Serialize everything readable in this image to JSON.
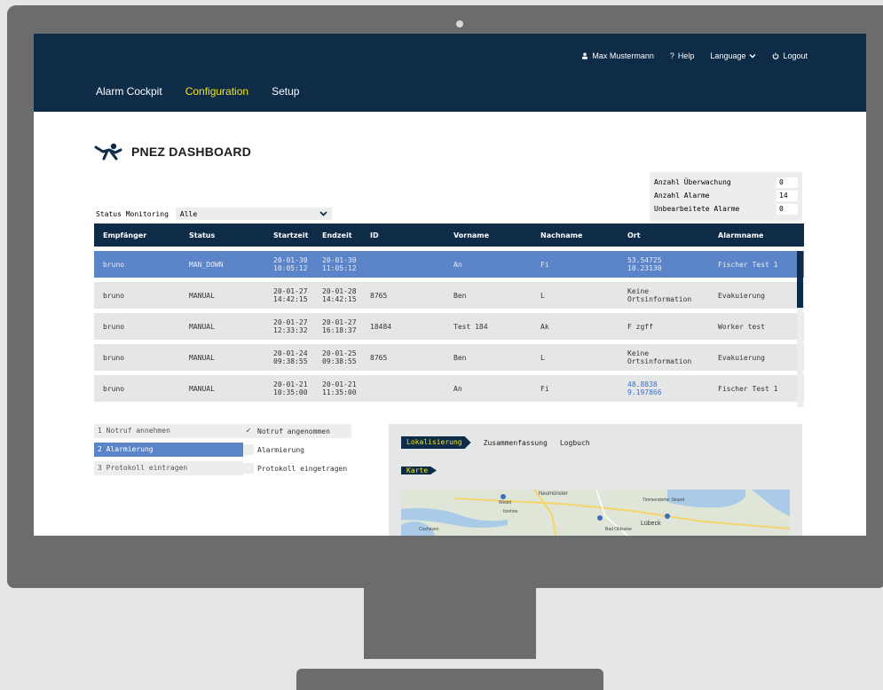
{
  "nav": {
    "user": "Max Mustermann",
    "help": "Help",
    "language": "Language",
    "logout": "Logout",
    "tabs": [
      "Alarm Cockpit",
      "Configuration",
      "Setup"
    ],
    "active_tab": "Configuration"
  },
  "dashboard": {
    "title": "PNEZ DASHBOARD"
  },
  "counts": [
    {
      "label": "Anzahl Überwachung",
      "value": "0"
    },
    {
      "label": "Anzahl Alarme",
      "value": "14"
    },
    {
      "label": "Unbearbeitete Alarme",
      "value": "0"
    }
  ],
  "filter": {
    "label": "Status Monitoring",
    "value": "Alle"
  },
  "table": {
    "headers": [
      "Empfänger",
      "Status",
      "Startzeit",
      "Endzeit",
      "ID",
      "Vorname",
      "Nachname",
      "Ort",
      "Alarmname"
    ],
    "rows": [
      {
        "empfaenger": "bruno",
        "status": "MAN_DOWN",
        "start1": "20-01-30",
        "start2": "10:05:12",
        "end1": "20-01-30",
        "end2": "11:05:12",
        "id": "",
        "vorname": "An",
        "nachname": "Fi",
        "ort1": "53.54725",
        "ort2": "10.23130",
        "ort_link": true,
        "alarmname": "Fischer Test 1",
        "selected": true
      },
      {
        "empfaenger": "bruno",
        "status": "MANUAL",
        "start1": "20-01-27",
        "start2": "14:42:15",
        "end1": "20-01-28",
        "end2": "14:42:15",
        "id": "8765",
        "vorname": "Ben",
        "nachname": "L",
        "ort1": "Keine",
        "ort2": "Ortsinformation",
        "ort_link": false,
        "alarmname": "Evakuierung",
        "selected": false
      },
      {
        "empfaenger": "bruno",
        "status": "MANUAL",
        "start1": "20-01-27",
        "start2": "12:33:32",
        "end1": "20-01-27",
        "end2": "16:18:37",
        "id": "18484",
        "vorname": "Test 184",
        "nachname": "Ak",
        "ort1": "F zgff",
        "ort2": "",
        "ort_link": false,
        "alarmname": "Worker test",
        "selected": false
      },
      {
        "empfaenger": "bruno",
        "status": "MANUAL",
        "start1": "20-01-24",
        "start2": "09:38:55",
        "end1": "20-01-25",
        "end2": "09:38:55",
        "id": "8765",
        "vorname": "Ben",
        "nachname": "L",
        "ort1": "Keine",
        "ort2": "Ortsinformation",
        "ort_link": false,
        "alarmname": "Evakuierung",
        "selected": false
      },
      {
        "empfaenger": "bruno",
        "status": "MANUAL",
        "start1": "20-01-21",
        "start2": "10:35:00",
        "end1": "20-01-21",
        "end2": "11:35:00",
        "id": "",
        "vorname": "An",
        "nachname": "Fi",
        "ort1": "48.8838",
        "ort2": "9.197866",
        "ort_link": true,
        "alarmname": "Fischer Test 1",
        "selected": false
      }
    ]
  },
  "steps": [
    {
      "label": "1 Notruf annehmen",
      "active": false
    },
    {
      "label": "2 Alarmierung",
      "active": true
    },
    {
      "label": "3 Protokoll eintragen",
      "active": false
    }
  ],
  "checklist": [
    {
      "label": "Notruf angenommen",
      "checked": true
    },
    {
      "label": "Alarmierung",
      "checked": false
    },
    {
      "label": "Protokoll eingetragen",
      "checked": false
    }
  ],
  "detail": {
    "tabs": [
      "Lokalisierung",
      "Zusammenfassung",
      "Logbuch"
    ],
    "active_tab": "Lokalisierung",
    "section": "Karte",
    "map_labels": [
      "Neumünster",
      "Wedel",
      "Itzehoe",
      "Cuxhaven",
      "Lübeck",
      "Timmendorfer Strand",
      "Bad Oldesloe"
    ]
  },
  "colors": {
    "navy": "#0e2b48",
    "accent_yellow": "#f0e422",
    "selected_blue": "#5b85c8",
    "link_blue": "#3c6fc5"
  }
}
